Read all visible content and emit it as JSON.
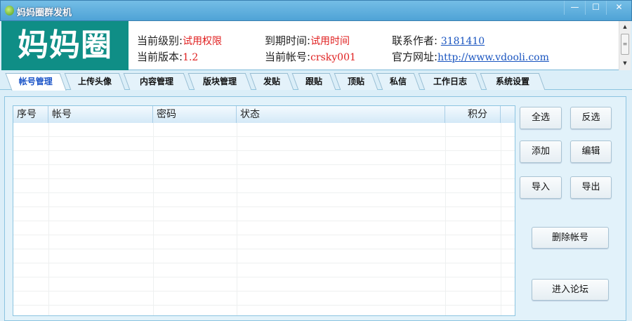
{
  "window": {
    "title": "妈妈圈群发机",
    "minimize": "—",
    "maximize": "☐",
    "close": "✕"
  },
  "header": {
    "logo": "妈妈圈",
    "level_label": "当前级别:",
    "level_value": "试用权限",
    "version_label": "当前版本:",
    "version_value": "1.2",
    "expire_label": "到期时间:",
    "expire_value": "试用时间",
    "account_label": "当前帐号:",
    "account_value": "crsky001",
    "contact_label": "联系作者: ",
    "contact_value": "3181410",
    "site_label": "官方网址:",
    "site_value": "http://www.vdooli.com"
  },
  "tabs": [
    "帐号管理",
    "上传头像",
    "内容管理",
    "版块管理",
    "发贴",
    "跟贴",
    "顶贴",
    "私信",
    "工作日志",
    "系统设置"
  ],
  "table": {
    "columns": [
      "序号",
      "帐号",
      "密码",
      "状态",
      "积分"
    ]
  },
  "buttons": {
    "select_all": "全选",
    "invert": "反选",
    "add": "添加",
    "edit": "编辑",
    "import": "导入",
    "export": "导出",
    "delete": "删除帐号",
    "enter_forum": "进入论坛"
  }
}
